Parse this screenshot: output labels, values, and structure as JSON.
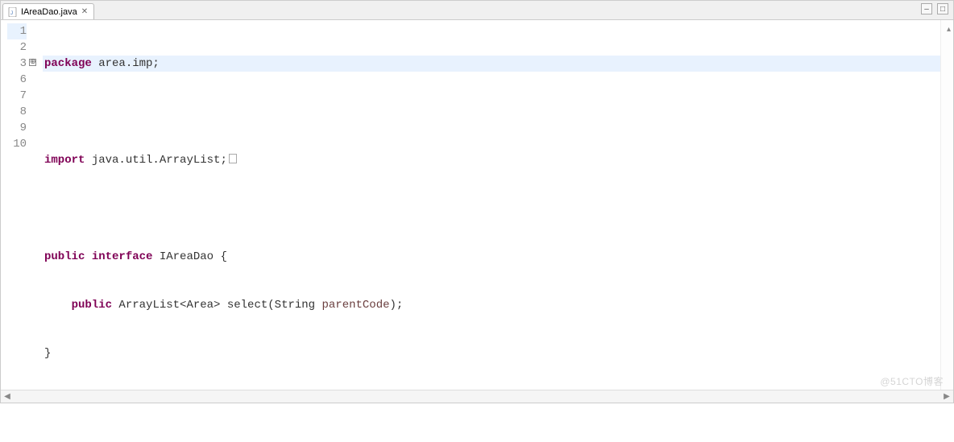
{
  "tab": {
    "filename": "IAreaDao.java",
    "close_glyph": "✕"
  },
  "window_controls": {
    "minimize": "–",
    "maximize": "□"
  },
  "gutter": {
    "lines": [
      "1",
      "2",
      "3",
      "6",
      "7",
      "8",
      "9",
      "10"
    ],
    "fold_line_index": 2,
    "fold_glyph": "⊕"
  },
  "code": {
    "l1": {
      "kw": "package",
      "rest": " area.imp;"
    },
    "l2": "",
    "l3": {
      "kw": "import",
      "rest": " java.util.ArrayList;"
    },
    "l4": "",
    "l5": {
      "kw1": "public",
      "kw2": "interface",
      "name": " IAreaDao ",
      "brace": "{"
    },
    "l6": {
      "indent": "    ",
      "kw": "public",
      "rest1": " ArrayList<Area> select(String ",
      "param": "parentCode",
      "rest2": ");"
    },
    "l7": "}",
    "l8": ""
  },
  "scroll": {
    "left_arrow": "◀",
    "right_arrow": "▶",
    "ruler_caret": "▴"
  },
  "watermark": "@51CTO博客"
}
